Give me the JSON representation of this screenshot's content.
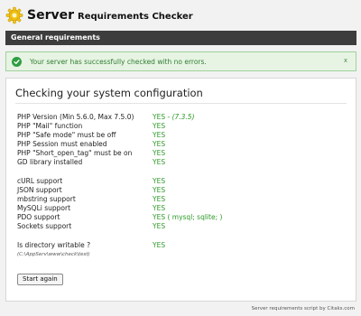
{
  "header": {
    "title_main": "Server",
    "title_sub": "Requirements Checker",
    "logo_icon": "gear-icon",
    "accent_color": "#f2c316"
  },
  "section": {
    "title": "General requirements"
  },
  "alert": {
    "message": "Your server has successfully checked with no errors.",
    "close_label": "x",
    "icon": "check-circle-icon",
    "color": "#2f9e41"
  },
  "panel": {
    "title": "Checking your system configuration",
    "rows": [
      {
        "label": "PHP Version (Min 5.6.0, Max 7.5.0)",
        "value": "YES - ",
        "extra": "(7.3.5)"
      },
      {
        "label": "PHP \"Mail\" function",
        "value": "YES"
      },
      {
        "label": "PHP \"Safe mode\" must be off",
        "value": "YES"
      },
      {
        "label": "PHP Session must enabled",
        "value": "YES"
      },
      {
        "label": "PHP \"Short_open_tag\" must be on",
        "value": "YES"
      },
      {
        "label": "GD library installed",
        "value": "YES"
      },
      {
        "label": "cURL support",
        "value": "YES"
      },
      {
        "label": "JSON support",
        "value": "YES"
      },
      {
        "label": "mbstring support",
        "value": "YES"
      },
      {
        "label": "MySQLi support",
        "value": "YES"
      },
      {
        "label": "PDO support",
        "value": "YES ( mysql; sqlite; )"
      },
      {
        "label": "Sockets support",
        "value": "YES"
      },
      {
        "label": "Is directory writable ?",
        "value": "YES"
      }
    ],
    "directory_path": "(C:\\AppServ\\www\\check\\test)",
    "button_label": "Start again"
  },
  "footer": {
    "credit": "Server requirements script by Citaks.com"
  }
}
